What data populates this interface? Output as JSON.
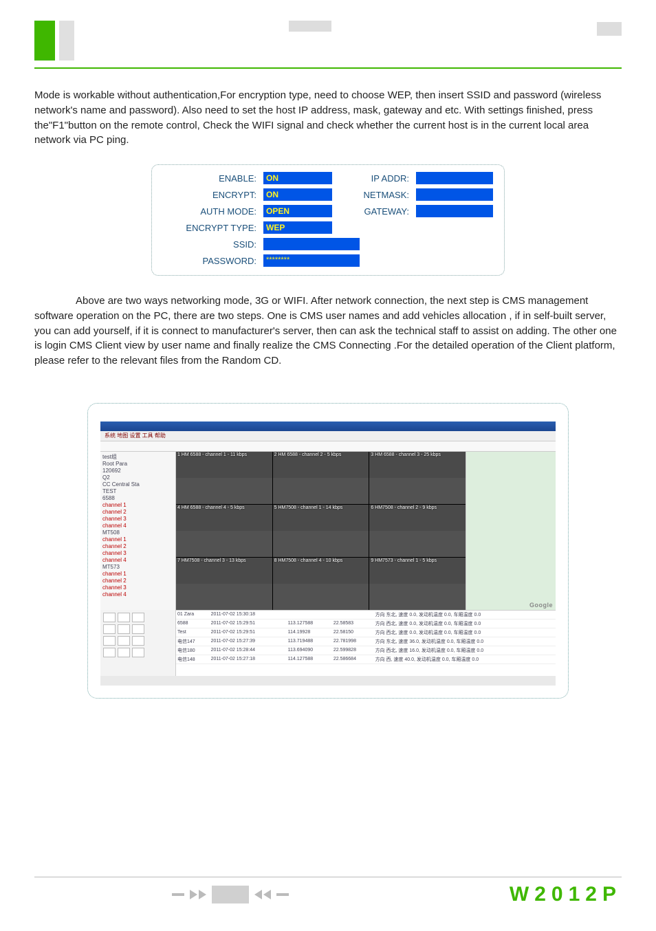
{
  "paragraph1": "Mode is workable without authentication,For encryption type, need to choose WEP, then insert SSID and password (wireless network's name and password). Also need to set the host IP address, mask, gateway and etc. With settings finished, press the\"F1\"button on the remote control, Check the WIFI signal and check whether the current host is in the current local area network via PC ping.",
  "wifi": {
    "enable_label": "ENABLE:",
    "enable_value": "ON",
    "encrypt_label": "ENCRYPT:",
    "encrypt_value": "ON",
    "authmode_label": "AUTH MODE:",
    "authmode_value": "OPEN",
    "encrypttype_label": "ENCRYPT TYPE:",
    "encrypttype_value": "WEP",
    "ssid_label": "SSID:",
    "password_label": "PASSWORD:",
    "password_value": "********",
    "ipaddr_label": "IP ADDR:",
    "netmask_label": "NETMASK:",
    "gateway_label": "GATEWAY:"
  },
  "paragraph2": "Above are two ways networking mode, 3G or WIFI. After network connection, the next step is CMS management software operation on the PC, there are two steps. One is  CMS user names and add vehicles allocation , if in self-built server, you can add yourself,  if it is connect to manufacturer's server, then can ask the technical staff to assist on adding. The other one is login CMS Client view by user name and finally realize the CMS Connecting .For the detailed operation of the Client platform, please refer to the relevant files from the Random CD.",
  "cms": {
    "menu_text": "系统 地图 设置 工具 帮助",
    "tree": [
      "test组",
      "  Root Para",
      "  120692",
      "  Q2",
      "  CC Central Sta",
      "TEST",
      "  6588",
      "  channel 1",
      "  channel 2",
      "  channel 3",
      "  channel 4",
      "  MT508",
      "  channel 1",
      "  channel 2",
      "  channel 3",
      "  channel 4",
      "  MT573",
      "  channel 1",
      "  channel 2",
      "  channel 3",
      "  channel 4"
    ],
    "cells": [
      "1  HM 6588 - channel 1 - 11 kbps",
      "2  HM 6588 - channel 2 - 5 kbps",
      "3  HM 6588 - channel 3 - 25 kbps",
      "4  HM 6588 - channel 4 - 5 kbps",
      "5  HM7508 - channel 1 - 14 kbps",
      "6  HM7508 - channel 2 - 9 kbps",
      "7  HM7508 - channel 3 - 13 kbps",
      "8  HM7508 - channel 4 - 10 kbps",
      "9  HM7573 - channel 1 - 5 kbps"
    ],
    "log_rows": [
      [
        "01 Zara",
        "2011-07-02 15:30:18",
        "",
        "",
        "方向 东北, 速度 0.0, 发动机温度 0.0, 车厢温度 0.0"
      ],
      [
        "6588",
        "2011-07-02 15:29:51",
        "113.127588",
        "22.58583",
        "方向 西北, 速度 0.0, 发动机温度 0.0, 车厢温度 0.0"
      ],
      [
        "Test",
        "2011-07-02 15:29:51",
        "114.19928",
        "22.58150",
        "方向 西北, 速度 0.0, 发动机温度 0.0, 车厢温度 0.0"
      ],
      [
        "电信147",
        "2011-07-02 15:27:39",
        "113.719488",
        "22.781998",
        "方向 东北, 速度 36.0, 发动机温度 0.0, 车厢温度 0.0"
      ],
      [
        "电信180",
        "2011-07-02 15:28:44",
        "113.694090",
        "22.599828",
        "方向 西北, 速度 16.0, 发动机温度 0.0, 车厢温度 0.0"
      ],
      [
        "电信148",
        "2011-07-02 15:27:18",
        "114.127588",
        "22.586684",
        "方向 西, 速度 40.0, 发动机温度 0.0, 车厢温度 0.0"
      ]
    ],
    "map_brand": "Google"
  },
  "footer": {
    "model": "W2012P"
  }
}
